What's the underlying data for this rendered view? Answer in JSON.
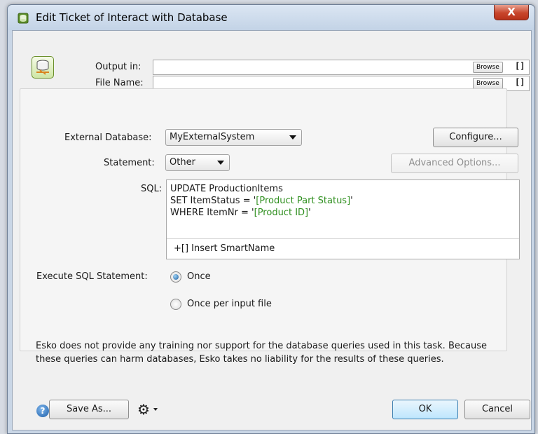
{
  "window": {
    "title": "Edit Ticket of Interact with Database",
    "close_glyph": "X"
  },
  "output": {
    "output_in_label": "Output in:",
    "output_in_value": "",
    "file_name_label": "File Name:",
    "file_name_value": "",
    "browse_label": "Browse",
    "smartname_glyph": "[]"
  },
  "database": {
    "label": "External Database:",
    "value": "MyExternalSystem",
    "configure_label": "Configure..."
  },
  "statement": {
    "label": "Statement:",
    "value": "Other",
    "advanced_label": "Advanced Options..."
  },
  "sql": {
    "label": "SQL:",
    "line1": "UPDATE ProductionItems",
    "line2_pre": "SET ItemStatus = '",
    "line2_sn": "[Product Part Status]",
    "line2_post": "'",
    "line3_pre": "WHERE ItemNr = '",
    "line3_sn": "[Product ID]",
    "line3_post": "'",
    "insert_smartname": "+[] Insert SmartName"
  },
  "execute": {
    "label": "Execute SQL Statement:",
    "option_once": "Once",
    "option_per_file": "Once per input file",
    "selected": "Once"
  },
  "disclaimer": "Esko does not provide any training nor support for the database queries used in this task. Because these queries can harm databases, Esko takes no liability for the results of these queries.",
  "footer": {
    "help_glyph": "?",
    "save_as_label": "Save As...",
    "ok_label": "OK",
    "cancel_label": "Cancel"
  },
  "icons": {
    "app": "db-icon",
    "bell": "bell-icon",
    "gear": "gear-icon",
    "help": "help-icon"
  },
  "colors": {
    "smartname": "#2f8f1f",
    "accent": "#3c7fb1"
  }
}
